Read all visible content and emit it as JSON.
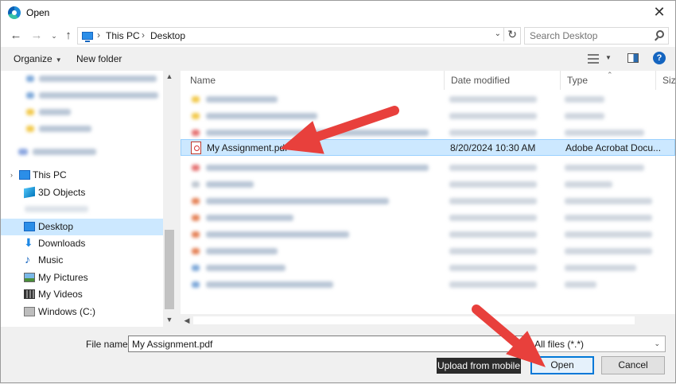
{
  "window": {
    "title": "Open",
    "close_label": "✕"
  },
  "address": {
    "crumbs": [
      "This PC",
      "Desktop"
    ],
    "search_placeholder": "Search Desktop"
  },
  "toolbar": {
    "organize_label": "Organize",
    "new_folder_label": "New folder",
    "help_label": "?"
  },
  "nav": {
    "this_pc": "This PC",
    "items": [
      {
        "label": "3D Objects",
        "icon": "cube-icon"
      },
      {
        "label": "Desktop",
        "icon": "desktop-icon",
        "selected": true
      },
      {
        "label": "Downloads",
        "icon": "download-icon"
      },
      {
        "label": "Music",
        "icon": "music-icon"
      },
      {
        "label": "My Pictures",
        "icon": "pictures-icon"
      },
      {
        "label": "My Videos",
        "icon": "videos-icon"
      },
      {
        "label": "Windows (C:)",
        "icon": "drive-icon"
      }
    ]
  },
  "columns": {
    "name": "Name",
    "date": "Date modified",
    "type": "Type",
    "size": "Size"
  },
  "selected_file": {
    "name": "My Assignment.pdf",
    "date": "8/20/2024 10:30 AM",
    "type": "Adobe Acrobat Docu..."
  },
  "bottom": {
    "file_name_label": "File name:",
    "file_name_value": "My Assignment.pdf",
    "file_type": "All files (*.*)",
    "tooltip": "Upload from mobile",
    "open_label": "Open",
    "cancel_label": "Cancel"
  },
  "colors": {
    "selection": "#cce8ff",
    "accent": "#0078d7",
    "arrow": "#e8403c"
  }
}
